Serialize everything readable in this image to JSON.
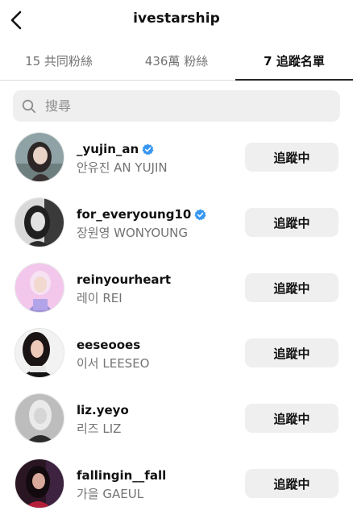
{
  "header": {
    "title": "ivestarship"
  },
  "tabs": [
    {
      "label": "15 共同粉絲"
    },
    {
      "label": "436萬 粉絲"
    },
    {
      "label": "7 追蹤名單"
    }
  ],
  "active_tab": 2,
  "search": {
    "placeholder": "搜尋",
    "value": ""
  },
  "following": [
    {
      "username": "_yujin_an",
      "full_name": "안유진 AN YUJIN",
      "verified": true,
      "button_label": "追蹤中"
    },
    {
      "username": "for_everyoung10",
      "full_name": "장원영 WONYOUNG",
      "verified": true,
      "button_label": "追蹤中"
    },
    {
      "username": "reinyourheart",
      "full_name": "레이 REI",
      "verified": false,
      "button_label": "追蹤中"
    },
    {
      "username": "eeseooes",
      "full_name": "이서 LEESEO",
      "verified": false,
      "button_label": "追蹤中"
    },
    {
      "username": "liz.yeyo",
      "full_name": "리즈 LIZ",
      "verified": false,
      "button_label": "追蹤中"
    },
    {
      "username": "fallingin__fall",
      "full_name": "가을 GAEUL",
      "verified": false,
      "button_label": "追蹤中"
    }
  ],
  "colors": {
    "verified_badge": "#3897f0",
    "button_bg": "#efefef",
    "secondary_text": "#737373"
  }
}
